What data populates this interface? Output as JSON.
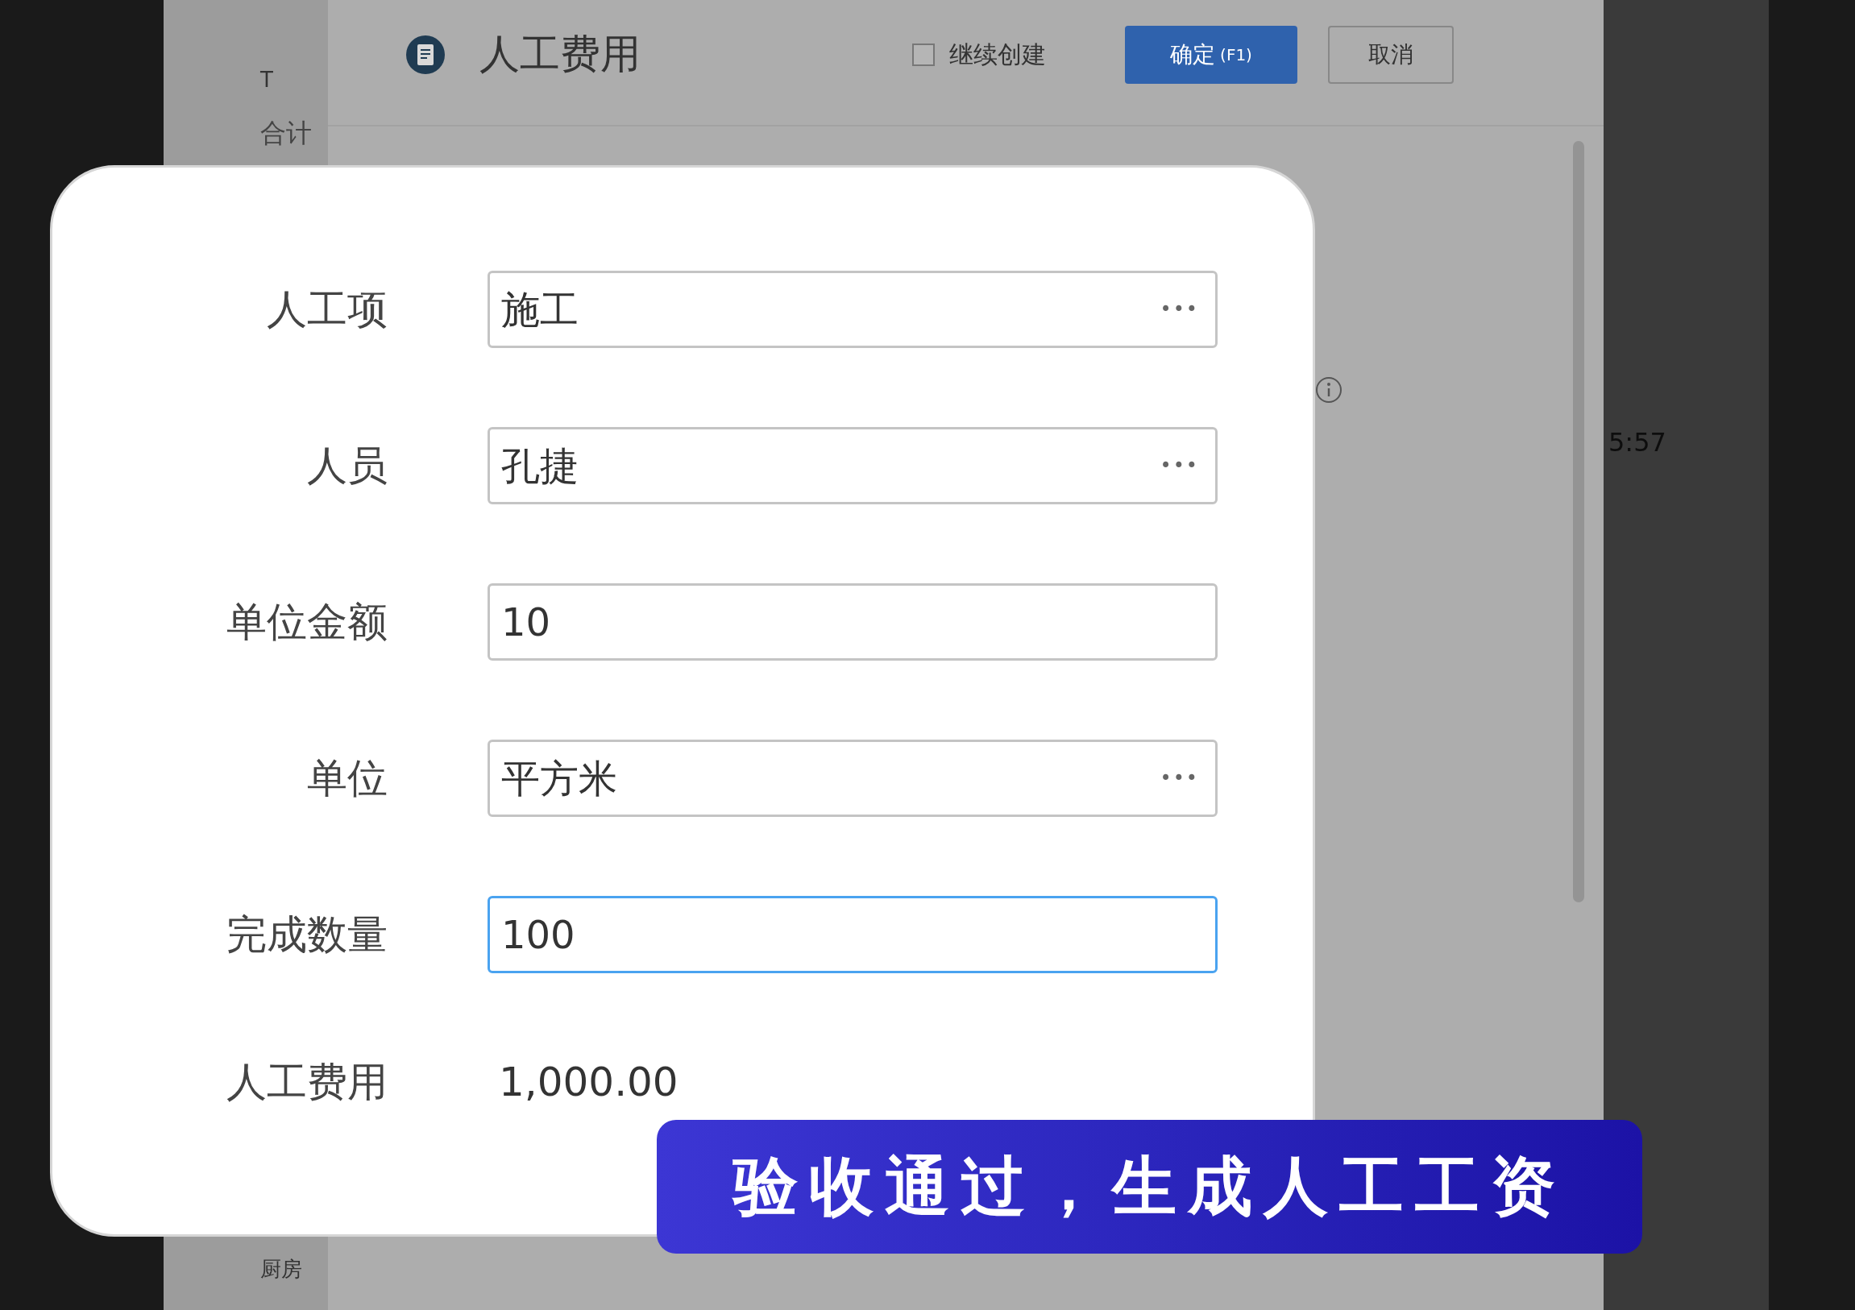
{
  "background": {
    "left_text": "T",
    "left_section": "合计",
    "left_bottom": "厨房",
    "right_time": "5:57"
  },
  "dialog": {
    "title": "人工费用",
    "continue_create": {
      "label": "继续创建",
      "checked": false
    },
    "confirm": {
      "label": "确定",
      "shortcut": "(F1)"
    },
    "cancel": "取消"
  },
  "form": [
    {
      "label": "人工项",
      "value": "施工",
      "kind": "picker",
      "focused": false,
      "more": "•••"
    },
    {
      "label": "人员",
      "value": "孔捷",
      "kind": "picker",
      "focused": false,
      "more": "•••"
    },
    {
      "label": "单位金额",
      "value": "10",
      "kind": "input",
      "focused": false
    },
    {
      "label": "单位",
      "value": "平方米",
      "kind": "picker",
      "focused": false,
      "more": "•••"
    },
    {
      "label": "完成数量",
      "value": "100",
      "kind": "input",
      "focused": true
    },
    {
      "label": "人工费用",
      "value": "1,000.00",
      "kind": "readonly"
    }
  ],
  "caption": "验收通过，生成人工工资"
}
